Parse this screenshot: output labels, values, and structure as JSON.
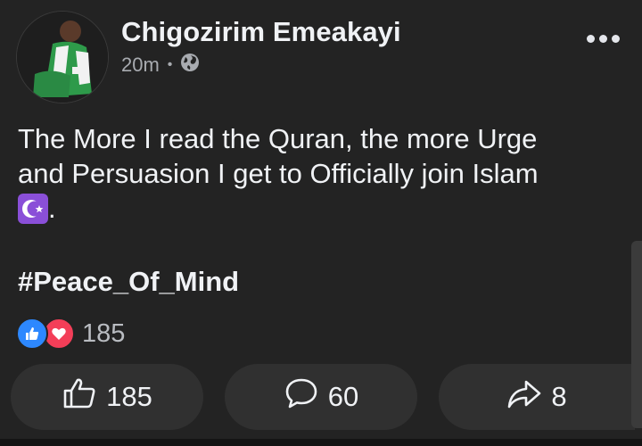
{
  "post": {
    "author": "Chigozirim Emeakayi",
    "time": "20m",
    "privacy_icon": "globe-icon",
    "menu_icon": "more-options-icon",
    "body_lines": [
      "The More I read the Quran, the more Urge",
      "and Persuasion I get to Officially join Islam"
    ],
    "body_tail": ".",
    "emoji": "star-and-crescent-emoji",
    "hashtag": "#Peace_Of_Mind",
    "reactions": {
      "icons": [
        "like-reaction-icon",
        "love-reaction-icon"
      ],
      "count": "185"
    },
    "actions": {
      "like_count": "185",
      "comment_count": "60",
      "share_count": "8"
    }
  },
  "colors": {
    "background": "#232323",
    "button_bg": "#303030",
    "like_blue": "#2d88ff",
    "love_red": "#f33e58",
    "emoji_purple": "#8a4fd8"
  }
}
